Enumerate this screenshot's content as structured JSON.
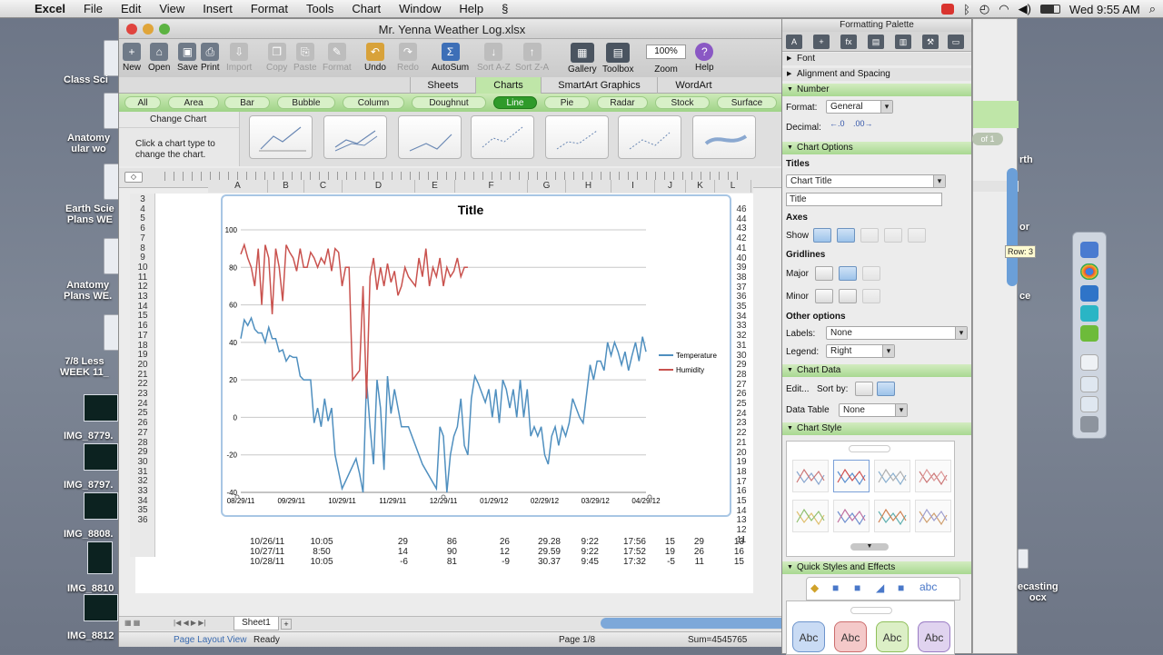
{
  "menubar": {
    "app": "Excel",
    "items": [
      "File",
      "Edit",
      "View",
      "Insert",
      "Format",
      "Tools",
      "Chart",
      "Window",
      "Help"
    ],
    "clock": "Wed 9:55 AM"
  },
  "desktop": {
    "items": [
      "Class Sci",
      "Anatomy\nular wo",
      "Earth Scie\nPlans WE",
      "Anatomy\nPlans WE.",
      "7/8 Less\nWEEK 11_",
      "IMG_8779.",
      "IMG_8797.",
      "IMG_8808.",
      "IMG_8810",
      "IMG_8812"
    ],
    "right_labels": [
      "rth",
      "or",
      "ce",
      "ecasting\nocx"
    ],
    "page_indicator": "of 1"
  },
  "window": {
    "title": "Mr. Yenna Weather Log.xlsx"
  },
  "toolbar": {
    "new": "New",
    "open": "Open",
    "save": "Save",
    "print": "Print",
    "import": "Import",
    "copy": "Copy",
    "paste": "Paste",
    "format": "Format",
    "undo": "Undo",
    "redo": "Redo",
    "autosum": "AutoSum",
    "sort_az": "Sort A-Z",
    "sort_za": "Sort Z-A",
    "gallery": "Gallery",
    "toolbox": "Toolbox",
    "zoom": "Zoom",
    "zoom_value": "100%",
    "help": "Help"
  },
  "ribbon": {
    "tabs": [
      "Sheets",
      "Charts",
      "SmartArt Graphics",
      "WordArt"
    ],
    "active_tab": "Charts"
  },
  "chart_gallery": {
    "types": [
      "All",
      "Area",
      "Bar",
      "Bubble",
      "Column",
      "Doughnut",
      "Line",
      "Pie",
      "Radar",
      "Stock",
      "Surface"
    ],
    "active": "Line",
    "change_chart": "Change Chart",
    "hint": "Click a chart type to\nchange the chart."
  },
  "columns": [
    "A",
    "B",
    "C",
    "D",
    "E",
    "F",
    "G",
    "H",
    "I",
    "J",
    "K",
    "L"
  ],
  "rows": [
    "3",
    "4",
    "5",
    "6",
    "7",
    "8",
    "9",
    "10",
    "11",
    "12",
    "13",
    "14",
    "15",
    "16",
    "17",
    "18",
    "19",
    "20",
    "21",
    "22",
    "23",
    "24",
    "25",
    "26",
    "27",
    "28",
    "29",
    "30",
    "31",
    "32",
    "33",
    "34",
    "35",
    "36"
  ],
  "right_numbers": [
    "46",
    "44",
    "43",
    "42",
    "41",
    "40",
    "39",
    "38",
    "37",
    "36",
    "35",
    "34",
    "33",
    "32",
    "31",
    "30",
    "29",
    "28",
    "27",
    "26",
    "25",
    "24",
    "23",
    "22",
    "21",
    "20",
    "19",
    "18",
    "17",
    "16",
    "15",
    "14",
    "13",
    "12",
    "11"
  ],
  "data_rows": [
    [
      "10/26/11",
      "10:05",
      "29",
      "86",
      "26",
      "29.28",
      "9:22",
      "17:56",
      "15",
      "29",
      "13"
    ],
    [
      "10/27/11",
      "8:50",
      "14",
      "90",
      "12",
      "29.59",
      "9:22",
      "17:52",
      "19",
      "26",
      "16"
    ],
    [
      "10/28/11",
      "10:05",
      "-6",
      "81",
      "-9",
      "30.37",
      "9:45",
      "17:32",
      "-5",
      "11",
      "15"
    ]
  ],
  "chart_data": {
    "type": "line",
    "title": "Title",
    "xlabel": "",
    "ylabel": "",
    "ylim": [
      -40,
      100
    ],
    "x": [
      "08/29/11",
      "09/29/11",
      "10/29/11",
      "11/29/11",
      "12/29/11",
      "01/29/12",
      "02/29/12",
      "03/29/12",
      "04/29/12"
    ],
    "yticks": [
      100,
      80,
      60,
      40,
      20,
      0,
      -20,
      -40
    ],
    "series": [
      {
        "name": "Temperature",
        "color": "#4f8fbf",
        "points": [
          [
            0,
            42
          ],
          [
            0.05,
            52
          ],
          [
            0.1,
            49
          ],
          [
            0.15,
            53
          ],
          [
            0.2,
            47
          ],
          [
            0.25,
            45
          ],
          [
            0.3,
            45
          ],
          [
            0.35,
            40
          ],
          [
            0.4,
            48
          ],
          [
            0.45,
            42
          ],
          [
            0.5,
            42
          ],
          [
            0.55,
            35
          ],
          [
            0.6,
            36
          ],
          [
            0.65,
            30
          ],
          [
            0.7,
            33
          ],
          [
            0.75,
            32
          ],
          [
            0.8,
            32
          ],
          [
            0.85,
            22
          ],
          [
            0.9,
            20
          ],
          [
            0.95,
            20
          ],
          [
            1.0,
            20
          ],
          [
            1.05,
            -3
          ],
          [
            1.1,
            5
          ],
          [
            1.15,
            -5
          ],
          [
            1.2,
            10
          ],
          [
            1.25,
            -2
          ],
          [
            1.3,
            5
          ],
          [
            1.35,
            -20
          ],
          [
            1.45,
            -38
          ],
          [
            1.55,
            -30
          ],
          [
            1.65,
            -22
          ],
          [
            1.7,
            -30
          ],
          [
            1.75,
            -40
          ],
          [
            1.8,
            20
          ],
          [
            1.85,
            -5
          ],
          [
            1.9,
            -25
          ],
          [
            1.95,
            20
          ],
          [
            2.0,
            5
          ],
          [
            2.05,
            -28
          ],
          [
            2.1,
            22
          ],
          [
            2.15,
            2
          ],
          [
            2.2,
            15
          ],
          [
            2.3,
            -5
          ],
          [
            2.4,
            -5
          ],
          [
            2.5,
            -15
          ],
          [
            2.6,
            -25
          ],
          [
            2.8,
            -38
          ],
          [
            2.85,
            -5
          ],
          [
            2.9,
            -10
          ],
          [
            2.95,
            -40
          ],
          [
            3.0,
            -20
          ],
          [
            3.05,
            -10
          ],
          [
            3.1,
            -5
          ],
          [
            3.15,
            10
          ],
          [
            3.2,
            -15
          ],
          [
            3.25,
            -20
          ],
          [
            3.3,
            10
          ],
          [
            3.35,
            22
          ],
          [
            3.4,
            18
          ],
          [
            3.5,
            8
          ],
          [
            3.55,
            15
          ],
          [
            3.6,
            0
          ],
          [
            3.65,
            15
          ],
          [
            3.7,
            -3
          ],
          [
            3.75,
            20
          ],
          [
            3.8,
            15
          ],
          [
            3.85,
            5
          ],
          [
            3.9,
            15
          ],
          [
            3.95,
            0
          ],
          [
            4.0,
            20
          ],
          [
            4.05,
            0
          ],
          [
            4.1,
            15
          ],
          [
            4.15,
            -10
          ],
          [
            4.2,
            -5
          ],
          [
            4.25,
            -10
          ],
          [
            4.3,
            -5
          ],
          [
            4.35,
            -20
          ],
          [
            4.4,
            -25
          ],
          [
            4.45,
            -10
          ],
          [
            4.5,
            -5
          ],
          [
            4.55,
            -15
          ],
          [
            4.6,
            -5
          ],
          [
            4.65,
            -10
          ],
          [
            4.7,
            -3
          ],
          [
            4.75,
            10
          ],
          [
            4.8,
            5
          ],
          [
            4.85,
            0
          ],
          [
            4.9,
            -3
          ],
          [
            5.0,
            28
          ],
          [
            5.05,
            20
          ],
          [
            5.1,
            30
          ],
          [
            5.15,
            30
          ],
          [
            5.2,
            25
          ],
          [
            5.25,
            40
          ],
          [
            5.3,
            33
          ],
          [
            5.35,
            40
          ],
          [
            5.4,
            35
          ],
          [
            5.45,
            28
          ],
          [
            5.5,
            35
          ],
          [
            5.55,
            25
          ],
          [
            5.6,
            33
          ],
          [
            5.65,
            40
          ],
          [
            5.7,
            30
          ],
          [
            5.75,
            43
          ],
          [
            5.8,
            35
          ]
        ]
      },
      {
        "name": "Humidity",
        "color": "#c9524e",
        "points": [
          [
            0,
            87
          ],
          [
            0.05,
            92
          ],
          [
            0.1,
            85
          ],
          [
            0.15,
            80
          ],
          [
            0.2,
            70
          ],
          [
            0.25,
            90
          ],
          [
            0.3,
            60
          ],
          [
            0.35,
            92
          ],
          [
            0.4,
            85
          ],
          [
            0.45,
            55
          ],
          [
            0.5,
            90
          ],
          [
            0.55,
            80
          ],
          [
            0.6,
            62
          ],
          [
            0.65,
            92
          ],
          [
            0.7,
            88
          ],
          [
            0.75,
            85
          ],
          [
            0.8,
            78
          ],
          [
            0.85,
            90
          ],
          [
            0.9,
            80
          ],
          [
            0.95,
            80
          ],
          [
            1.0,
            88
          ],
          [
            1.05,
            85
          ],
          [
            1.1,
            80
          ],
          [
            1.15,
            85
          ],
          [
            1.2,
            82
          ],
          [
            1.25,
            90
          ],
          [
            1.3,
            78
          ],
          [
            1.35,
            90
          ],
          [
            1.4,
            88
          ],
          [
            1.45,
            70
          ],
          [
            1.5,
            80
          ],
          [
            1.55,
            80
          ],
          [
            1.6,
            20
          ],
          [
            1.7,
            25
          ],
          [
            1.75,
            70
          ],
          [
            1.8,
            10
          ],
          [
            1.85,
            75
          ],
          [
            1.9,
            85
          ],
          [
            1.95,
            68
          ],
          [
            2.0,
            80
          ],
          [
            2.05,
            70
          ],
          [
            2.1,
            82
          ],
          [
            2.15,
            72
          ],
          [
            2.2,
            78
          ],
          [
            2.25,
            65
          ],
          [
            2.3,
            70
          ],
          [
            2.35,
            80
          ],
          [
            2.4,
            75
          ],
          [
            2.5,
            70
          ],
          [
            2.55,
            85
          ],
          [
            2.6,
            75
          ],
          [
            2.65,
            90
          ],
          [
            2.7,
            70
          ],
          [
            2.75,
            80
          ],
          [
            2.8,
            75
          ],
          [
            2.85,
            85
          ],
          [
            2.9,
            70
          ],
          [
            2.95,
            80
          ],
          [
            3.0,
            75
          ],
          [
            3.05,
            78
          ],
          [
            3.1,
            85
          ],
          [
            3.15,
            75
          ],
          [
            3.2,
            80
          ],
          [
            3.25,
            80
          ]
        ]
      }
    ]
  },
  "palette": {
    "title": "Formatting Palette",
    "sections": [
      "Font",
      "Alignment and Spacing",
      "Number",
      "Chart Options",
      "Chart Data",
      "Chart Style",
      "Quick Styles and Effects"
    ],
    "number": {
      "format_label": "Format:",
      "format_value": "General",
      "decimal_label": "Decimal:"
    },
    "chart_options": {
      "titles": "Titles",
      "title_select": "Chart Title",
      "title_value": "Title",
      "axes": "Axes",
      "show": "Show",
      "gridlines": "Gridlines",
      "major": "Major",
      "minor": "Minor",
      "other": "Other options",
      "labels": "Labels:",
      "labels_value": "None",
      "legend": "Legend:",
      "legend_value": "Right"
    },
    "chart_data": {
      "edit": "Edit...",
      "sort_by": "Sort by:",
      "data_table": "Data Table",
      "data_table_value": "None"
    },
    "quick_styles": [
      "Abc",
      "Abc",
      "Abc",
      "Abc"
    ],
    "quick_icon": "abc"
  },
  "tabs": {
    "sheet": "Sheet1"
  },
  "status": {
    "view": "Page Layout View",
    "ready": "Ready",
    "page": "Page 1/8",
    "sum": "Sum=4545765"
  },
  "row_tip": "Row: 3"
}
